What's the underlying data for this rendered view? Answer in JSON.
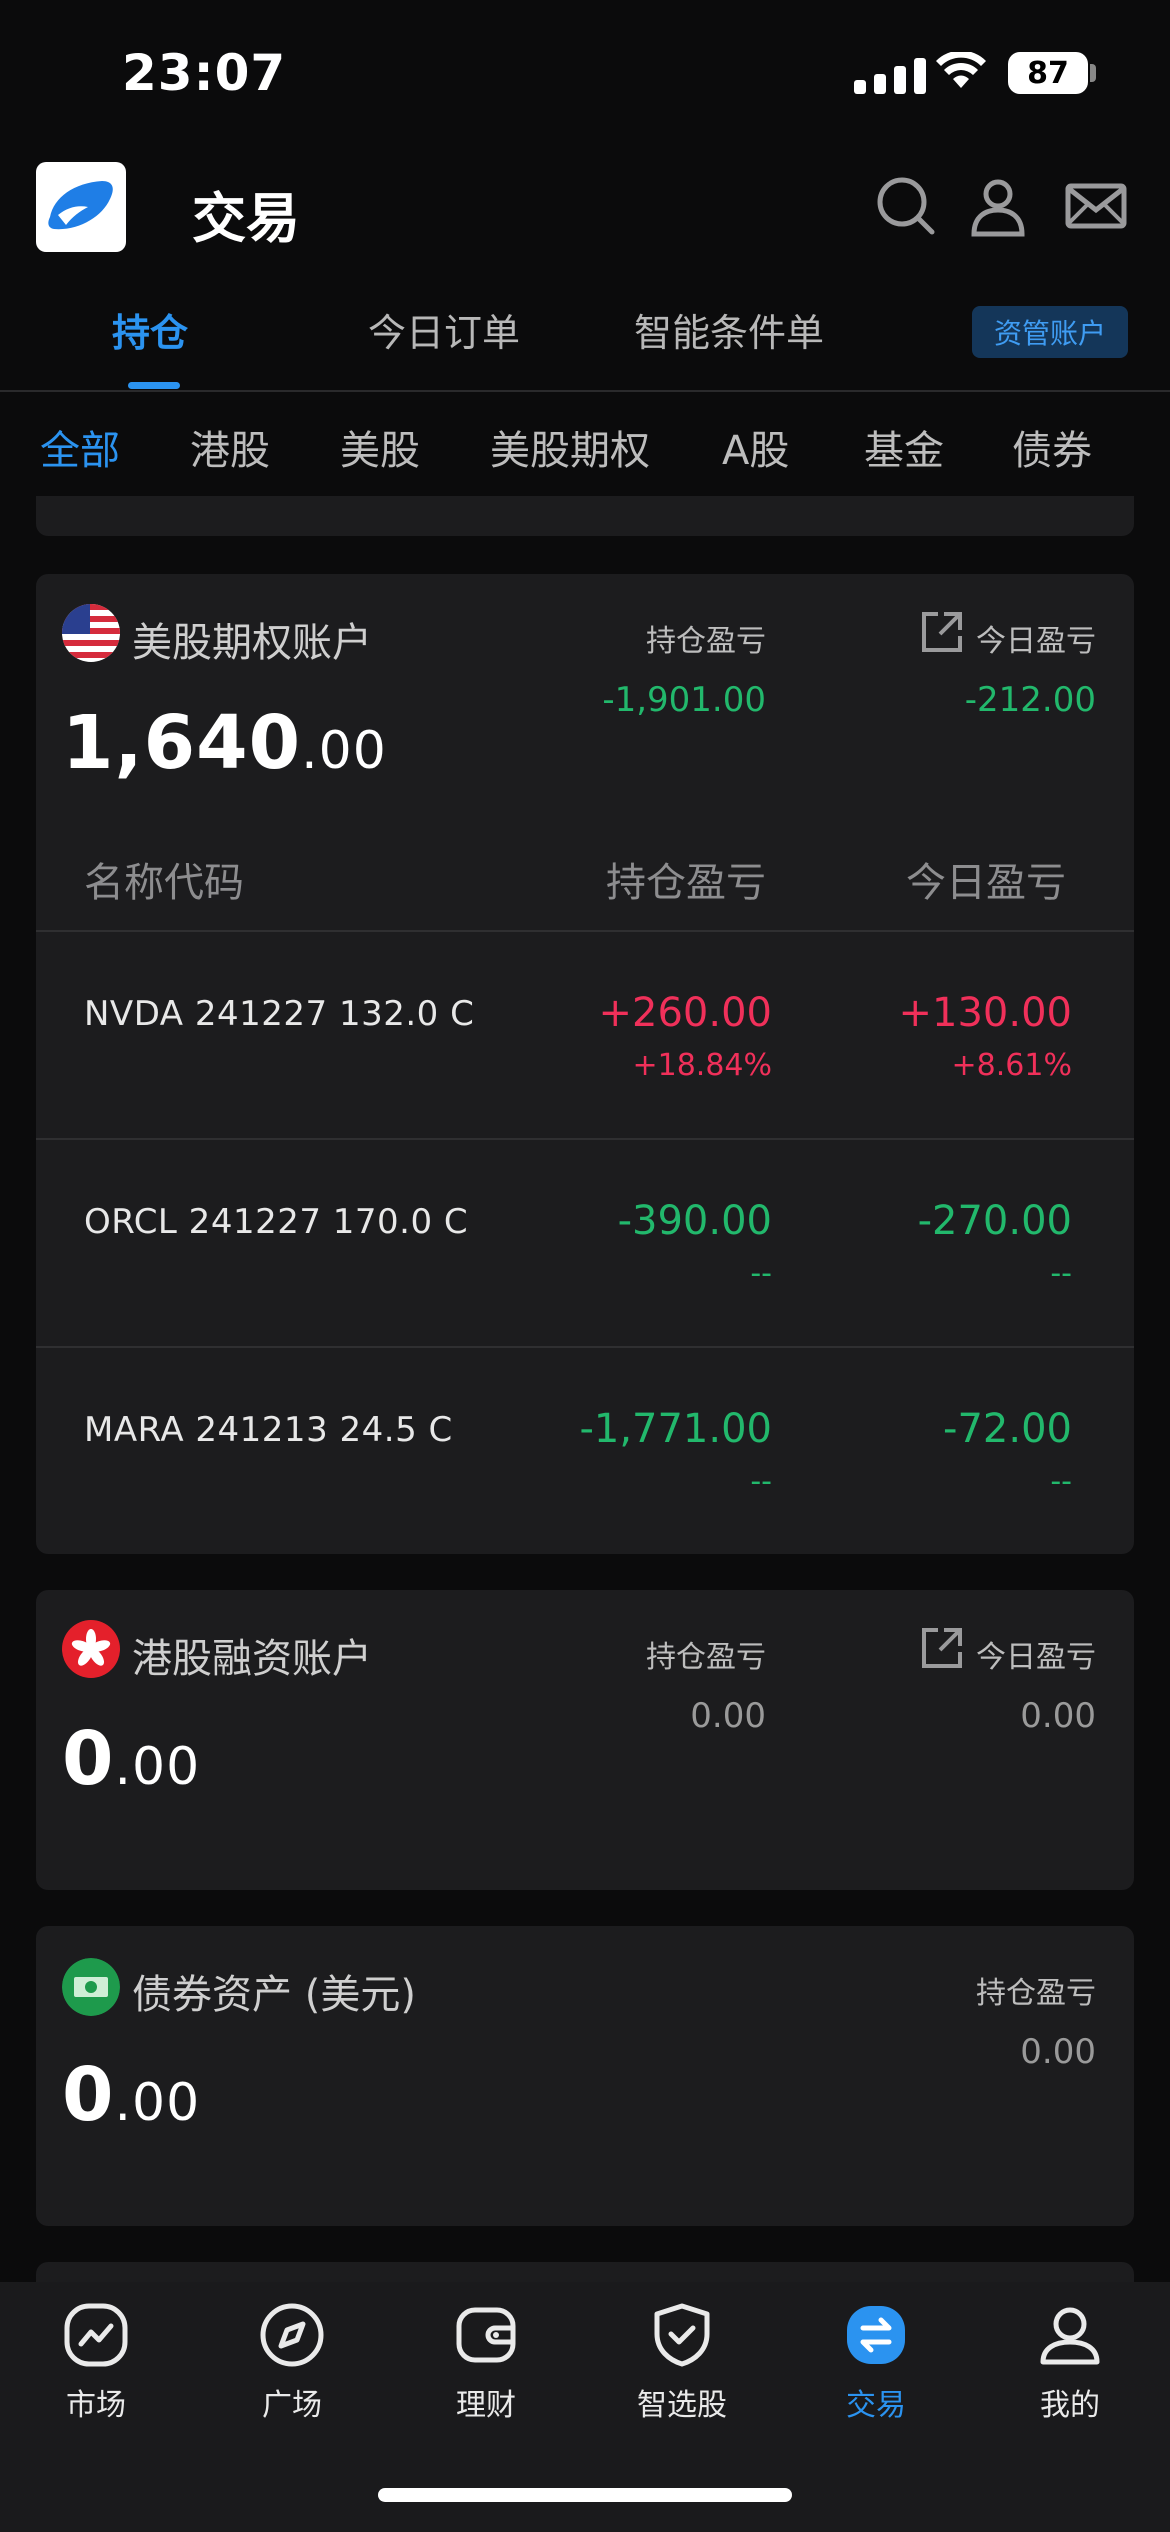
{
  "status": {
    "time": "23:07",
    "battery": "87"
  },
  "header": {
    "title": "交易"
  },
  "tabs": [
    {
      "label": "持仓"
    },
    {
      "label": "今日订单"
    },
    {
      "label": "智能条件单"
    }
  ],
  "asset_button": "资管账户",
  "filters": [
    "全部",
    "港股",
    "美股",
    "美股期权",
    "A股",
    "基金",
    "债券"
  ],
  "us_options": {
    "name": "美股期权账户",
    "total_int": "1,640",
    "total_dec": ".00",
    "pos_pl_label": "持仓盈亏",
    "pos_pl_value": "-1,901.00",
    "day_pl_label": "今日盈亏",
    "day_pl_value": "-212.00",
    "columns": [
      "名称代码",
      "持仓盈亏",
      "今日盈亏"
    ],
    "positions": [
      {
        "name": "NVDA 241227 132.0 C",
        "pl": "+260.00",
        "pl_pct": "+18.84%",
        "day": "+130.00",
        "day_pct": "+8.61%"
      },
      {
        "name": "ORCL 241227 170.0 C",
        "pl": "-390.00",
        "pl_pct": "--",
        "day": "-270.00",
        "day_pct": "--"
      },
      {
        "name": "MARA 241213 24.5 C",
        "pl": "-1,771.00",
        "pl_pct": "--",
        "day": "-72.00",
        "day_pct": "--"
      }
    ]
  },
  "hk_margin": {
    "name": "港股融资账户",
    "total_int": "0",
    "total_dec": ".00",
    "pos_pl_label": "持仓盈亏",
    "pos_pl_value": "0.00",
    "day_pl_label": "今日盈亏",
    "day_pl_value": "0.00"
  },
  "bond": {
    "name": "债券资产 (美元)",
    "total_int": "0",
    "total_dec": ".00",
    "pos_pl_label": "持仓盈亏",
    "pos_pl_value": "0.00"
  },
  "nav": [
    {
      "label": "市场",
      "icon": "chart-icon"
    },
    {
      "label": "广场",
      "icon": "compass-icon"
    },
    {
      "label": "理财",
      "icon": "wallet-icon"
    },
    {
      "label": "智选股",
      "icon": "shield-check-icon"
    },
    {
      "label": "交易",
      "icon": "trade-icon"
    },
    {
      "label": "我的",
      "icon": "user-icon"
    }
  ],
  "colors": {
    "accent": "#2b93f0",
    "gain": "#f0305a",
    "loss": "#22b86c",
    "card": "#1c1c1e"
  }
}
